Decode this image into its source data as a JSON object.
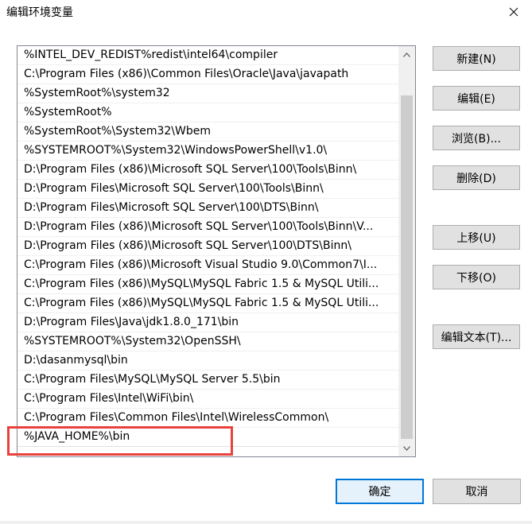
{
  "window": {
    "title": "编辑环境变量"
  },
  "list": {
    "items": [
      "%INTEL_DEV_REDIST%redist\\intel64\\compiler",
      "C:\\Program Files (x86)\\Common Files\\Oracle\\Java\\javapath",
      "%SystemRoot%\\system32",
      "%SystemRoot%",
      "%SystemRoot%\\System32\\Wbem",
      "%SYSTEMROOT%\\System32\\WindowsPowerShell\\v1.0\\",
      "D:\\Program Files (x86)\\Microsoft SQL Server\\100\\Tools\\Binn\\",
      "D:\\Program Files\\Microsoft SQL Server\\100\\Tools\\Binn\\",
      "D:\\Program Files\\Microsoft SQL Server\\100\\DTS\\Binn\\",
      "D:\\Program Files (x86)\\Microsoft SQL Server\\100\\Tools\\Binn\\V...",
      "D:\\Program Files (x86)\\Microsoft SQL Server\\100\\DTS\\Binn\\",
      "C:\\Program Files (x86)\\Microsoft Visual Studio 9.0\\Common7\\I...",
      "C:\\Program Files (x86)\\MySQL\\MySQL Fabric 1.5 & MySQL Utili...",
      "C:\\Program Files (x86)\\MySQL\\MySQL Fabric 1.5 & MySQL Utili...",
      "D:\\Program Files\\Java\\jdk1.8.0_171\\bin",
      "%SYSTEMROOT%\\System32\\OpenSSH\\",
      "D:\\dasanmysql\\bin",
      "C:\\Program Files\\MySQL\\MySQL Server 5.5\\bin",
      "C:\\Program Files\\Intel\\WiFi\\bin\\",
      "C:\\Program Files\\Common Files\\Intel\\WirelessCommon\\",
      "%JAVA_HOME%\\bin",
      ""
    ]
  },
  "buttons": {
    "new": "新建(N)",
    "edit": "编辑(E)",
    "browse": "浏览(B)...",
    "delete": "删除(D)",
    "move_up": "上移(U)",
    "move_down": "下移(O)",
    "edit_text": "编辑文本(T)...",
    "ok": "确定",
    "cancel": "取消"
  },
  "colors": {
    "highlight": "#e8423f",
    "primary_border": "#0078d7"
  }
}
